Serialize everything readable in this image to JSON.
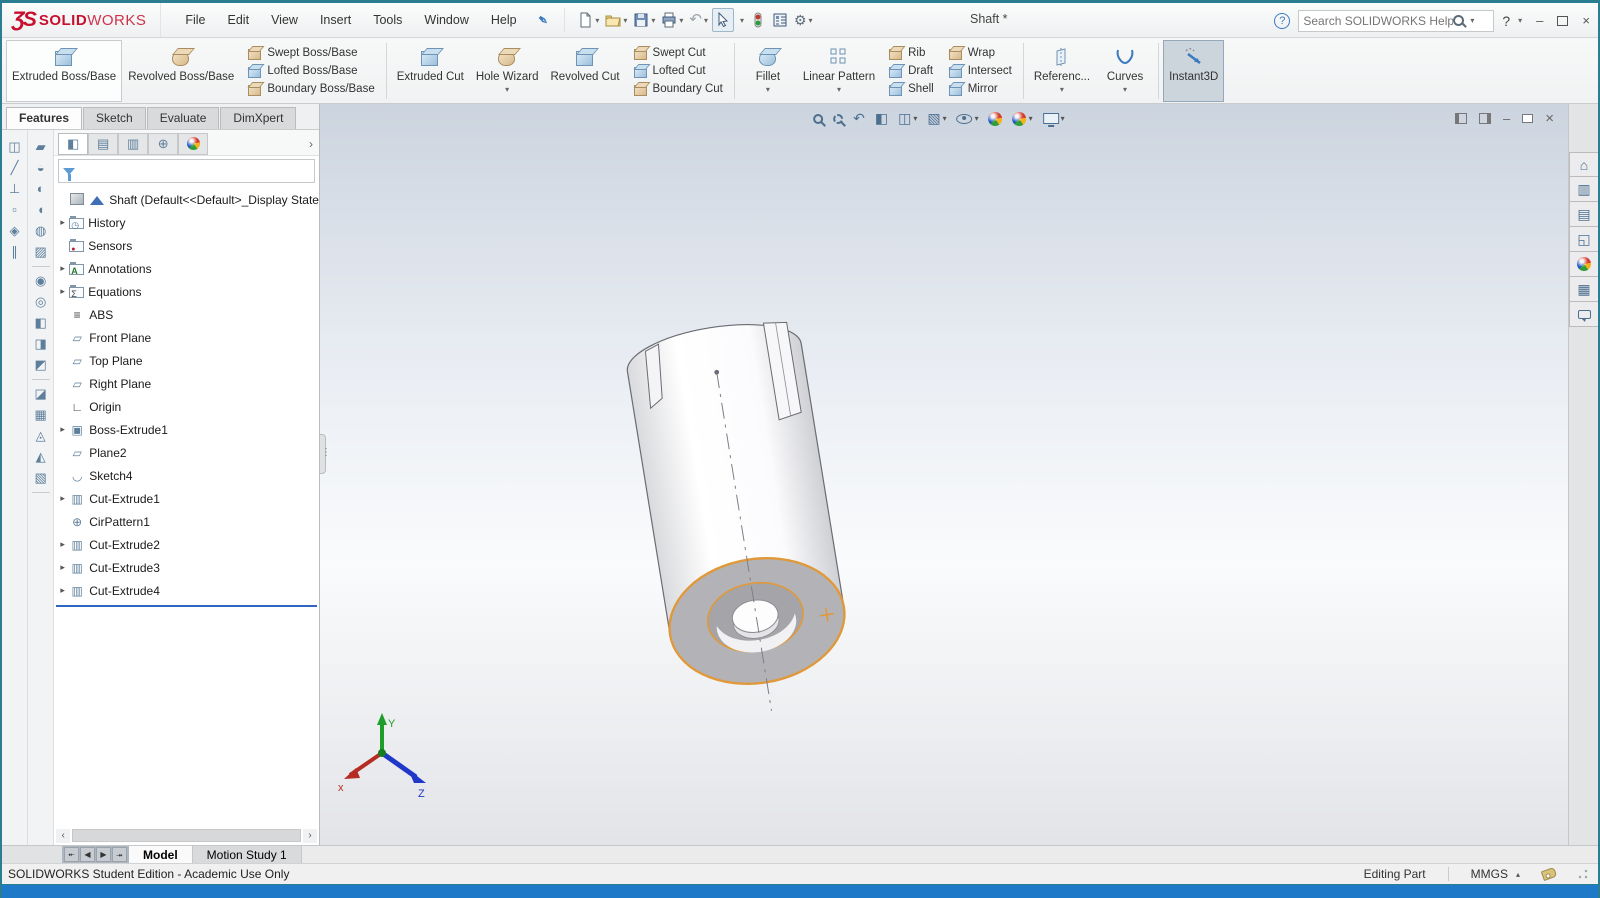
{
  "window": {
    "title": "Shaft *"
  },
  "titlebar": {
    "logo": {
      "mark": "ƷS",
      "bold": "SOLID",
      "light": "WORKS"
    },
    "menus": [
      "File",
      "Edit",
      "View",
      "Insert",
      "Tools",
      "Window",
      "Help"
    ],
    "search_placeholder": "Search SOLIDWORKS Help",
    "help_label": "?",
    "quick_tools": [
      "new-document",
      "open",
      "save",
      "print",
      "undo",
      "select",
      "selection-filter",
      "command-options",
      "settings"
    ]
  },
  "ribbon": {
    "extruded_boss": "Extruded Boss/Base",
    "revolved_boss": "Revolved Boss/Base",
    "swept_boss": "Swept Boss/Base",
    "lofted_boss": "Lofted Boss/Base",
    "boundary_boss": "Boundary Boss/Base",
    "extruded_cut": "Extruded Cut",
    "hole_wizard": "Hole Wizard",
    "revolved_cut": "Revolved Cut",
    "swept_cut": "Swept Cut",
    "lofted_cut": "Lofted Cut",
    "boundary_cut": "Boundary Cut",
    "fillet": "Fillet",
    "linear_pattern": "Linear Pattern",
    "rib": "Rib",
    "draft": "Draft",
    "shell": "Shell",
    "wrap": "Wrap",
    "intersect": "Intersect",
    "mirror": "Mirror",
    "reference": "Referenc...",
    "curves": "Curves",
    "instant3d": "Instant3D"
  },
  "command_tabs": {
    "features": "Features",
    "sketch": "Sketch",
    "evaluate": "Evaluate",
    "dimxpert": "DimXpert"
  },
  "tree": {
    "root": "Shaft  (Default<<Default>_Display State",
    "items": [
      {
        "label": "History",
        "expandable": true
      },
      {
        "label": "Sensors",
        "expandable": false
      },
      {
        "label": "Annotations",
        "expandable": true
      },
      {
        "label": "Equations",
        "expandable": true
      },
      {
        "label": "ABS",
        "expandable": false
      },
      {
        "label": "Front Plane",
        "expandable": false
      },
      {
        "label": "Top Plane",
        "expandable": false
      },
      {
        "label": "Right Plane",
        "expandable": false
      },
      {
        "label": "Origin",
        "expandable": false
      },
      {
        "label": "Boss-Extrude1",
        "expandable": true
      },
      {
        "label": "Plane2",
        "expandable": false
      },
      {
        "label": "Sketch4",
        "expandable": false
      },
      {
        "label": "Cut-Extrude1",
        "expandable": true
      },
      {
        "label": "CirPattern1",
        "expandable": false
      },
      {
        "label": "Cut-Extrude2",
        "expandable": true
      },
      {
        "label": "Cut-Extrude3",
        "expandable": true
      },
      {
        "label": "Cut-Extrude4",
        "expandable": true
      }
    ]
  },
  "headsup_icons": [
    "zoom-to-fit",
    "zoom-to-area",
    "previous-view",
    "section-view",
    "view-orientation",
    "display-style",
    "hide-show-items",
    "edit-appearance",
    "apply-scene",
    "view-settings"
  ],
  "taskpane_icons": [
    "solidworks-resources",
    "design-library",
    "file-explorer",
    "view-palette",
    "appearances-scenes",
    "custom-properties",
    "solidworks-forum"
  ],
  "doc_window_controls": [
    "collapse-pane-left",
    "collapse-pane-right",
    "minimize-document",
    "restore-document",
    "close-document"
  ],
  "bottom_tabs": {
    "model": "Model",
    "motion_study": "Motion Study 1"
  },
  "statusbar": {
    "message": "SOLIDWORKS Student Edition - Academic Use Only",
    "mode": "Editing Part",
    "units": "MMGS"
  },
  "triad": {
    "x": "x",
    "y": "Y",
    "z": "Z"
  }
}
